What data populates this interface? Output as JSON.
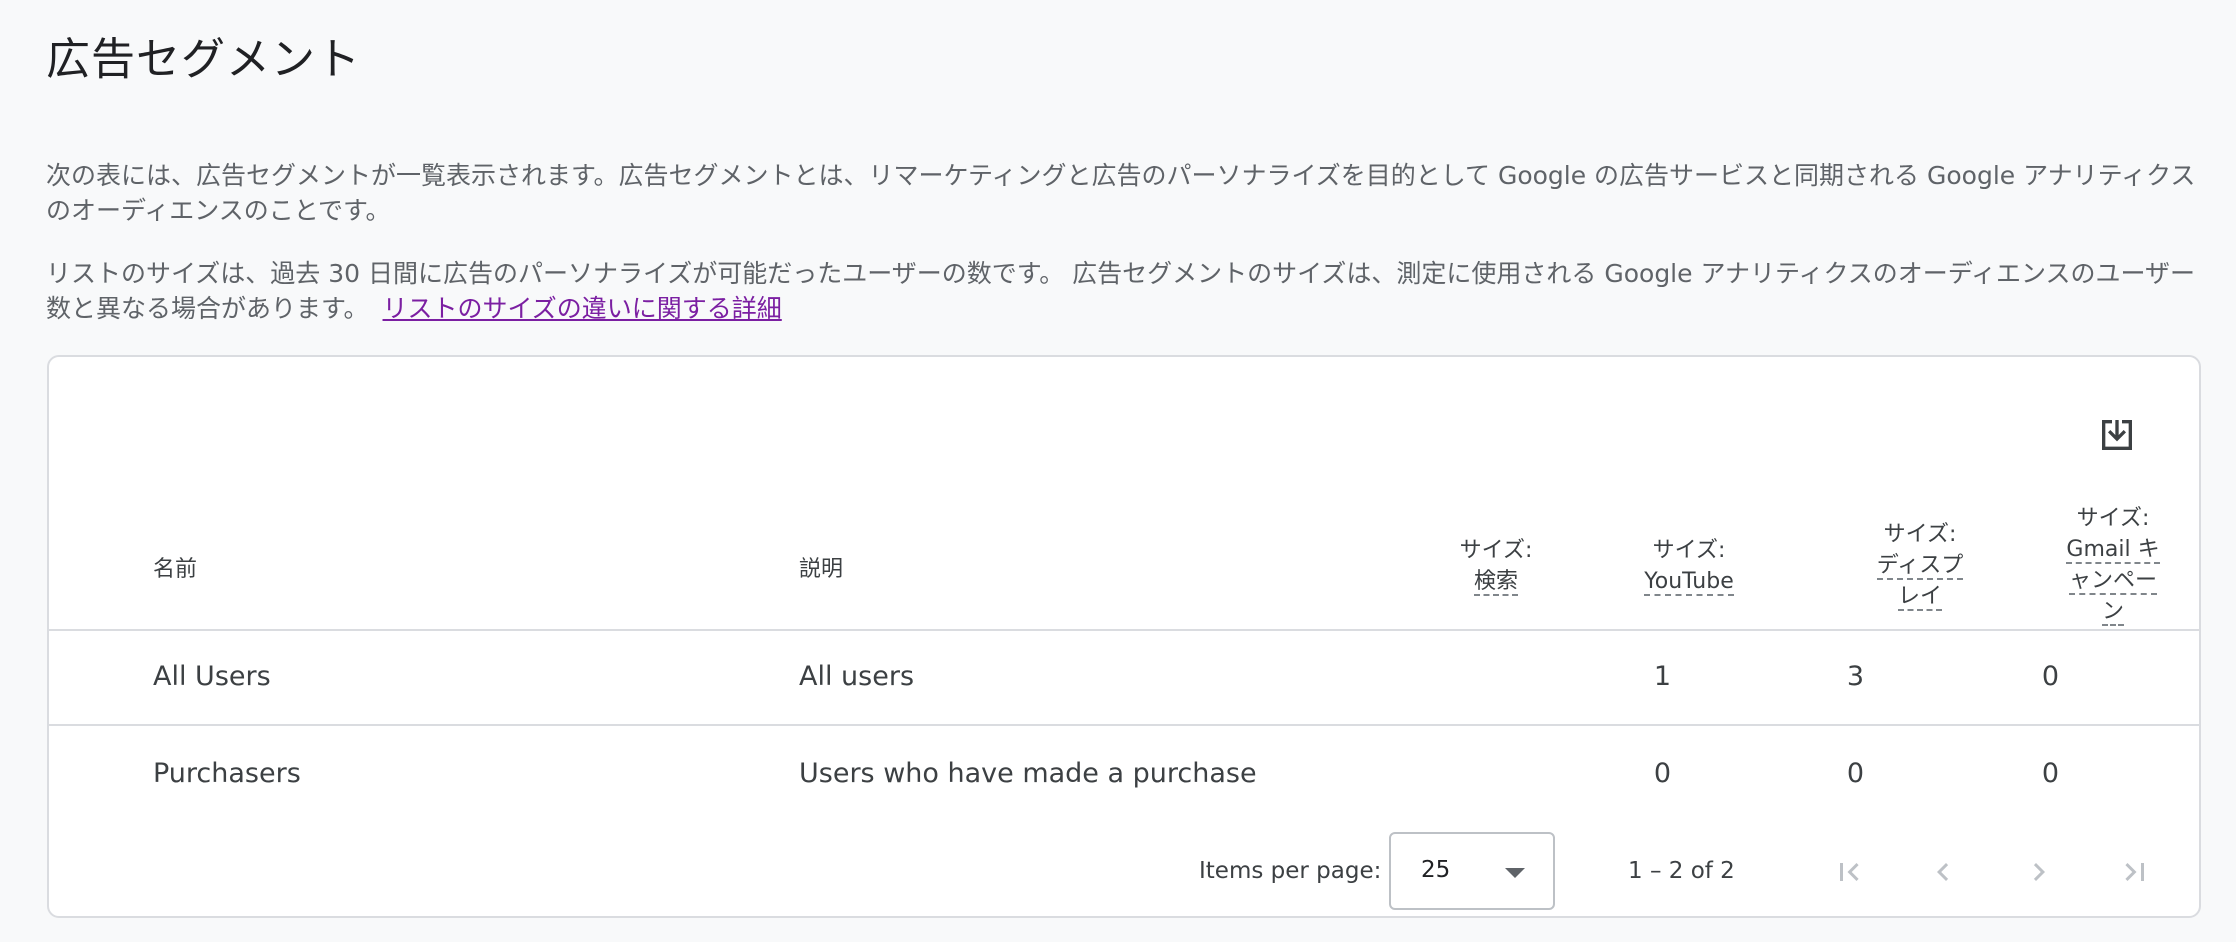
{
  "page": {
    "title": "広告セグメント",
    "description1": "次の表には、広告セグメントが一覧表示されます。広告セグメントとは、リマーケティングと広告のパーソナライズを目的として Google の広告サービスと同期される Google アナリティクスのオーディエンスのことです。",
    "description2": "リストのサイズは、過去 30 日間に広告のパーソナライズが可能だったユーザーの数です。 広告セグメントのサイズは、測定に使用される Google アナリティクスのオーディエンスのユーザー数と異なる場合があります。",
    "learn_more_link": "リストのサイズの違いに関する詳細"
  },
  "table": {
    "download_icon": "download-icon",
    "columns": {
      "name": "名前",
      "description": "説明",
      "size_search_prefix": "サイズ:",
      "size_search": "検索",
      "size_youtube_prefix": "サイズ:",
      "size_youtube": "YouTube",
      "size_display_prefix": "サイズ:",
      "size_display": "ディスプレイ",
      "size_gmail_prefix": "サイズ:",
      "size_gmail": "Gmail キャンペーン"
    },
    "rows": [
      {
        "name": "All Users",
        "description": "All users",
        "search": "1",
        "youtube": "3",
        "display": "0",
        "gmail": "0"
      },
      {
        "name": "Purchasers",
        "description": "Users who have made a purchase",
        "search": "0",
        "youtube": "0",
        "display": "0",
        "gmail": "0"
      }
    ]
  },
  "paginator": {
    "items_per_page_label": "Items per page:",
    "items_per_page_value": "25",
    "range_label": "1 – 2 of 2"
  },
  "colors": {
    "link": "#7b1fa2",
    "border": "#dadce0",
    "background": "#f8f9fa",
    "disabled_icon": "#bdc1c6"
  }
}
